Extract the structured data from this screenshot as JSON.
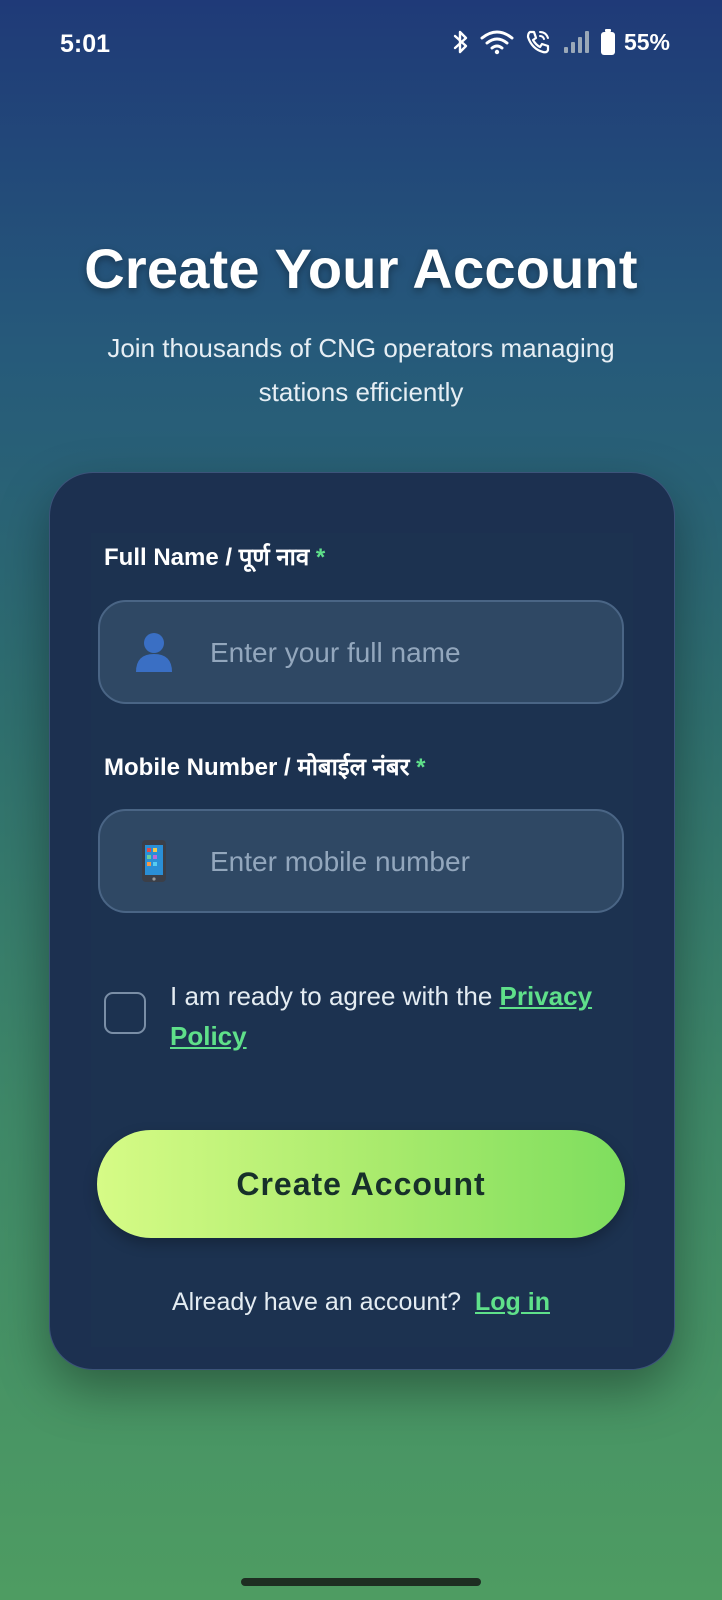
{
  "status_bar": {
    "time": "5:01",
    "battery": "55%"
  },
  "header": {
    "title": "Create Your Account",
    "subtitle": "Join thousands of CNG operators managing stations efficiently"
  },
  "form": {
    "full_name": {
      "label": "Full Name / पूर्ण नाव",
      "required_mark": "*",
      "placeholder": "Enter your full name",
      "value": "",
      "icon": "person-icon"
    },
    "mobile": {
      "label": "Mobile Number / मोबाईल नंबर",
      "required_mark": "*",
      "placeholder": "Enter mobile number",
      "value": "",
      "icon": "mobile-phone-icon"
    },
    "agreement": {
      "checked": false,
      "text": "I am ready to agree with the ",
      "link_text": "Privacy Policy"
    },
    "submit_label": "Create Account",
    "login_prompt": "Already have an account?",
    "login_link": "Log in"
  },
  "colors": {
    "accent_green": "#5fe08a",
    "button_gradient_start": "#d6fb86",
    "button_gradient_end": "#7ede5e",
    "card_background": "#1c3050"
  }
}
